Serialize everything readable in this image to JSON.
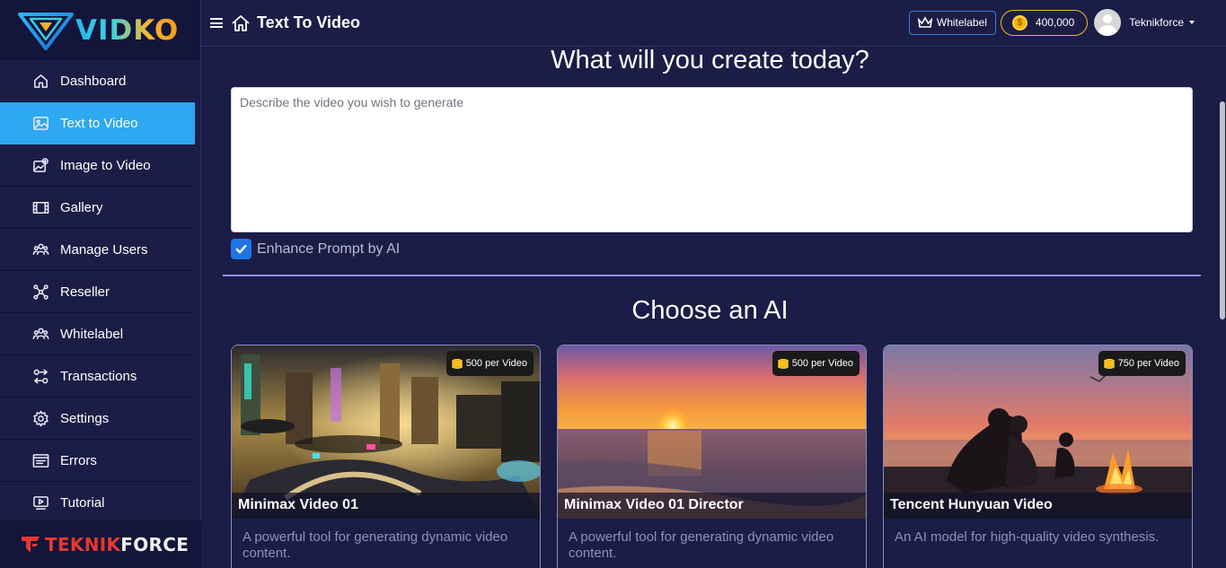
{
  "brand": {
    "logo_text": "VIDKO",
    "footer_red": "TEKNIK",
    "footer_white": "FORCE"
  },
  "sidebar": {
    "items": [
      {
        "label": "Dashboard",
        "icon": "home-icon",
        "active": false
      },
      {
        "label": "Text to Video",
        "icon": "image-icon",
        "active": true
      },
      {
        "label": "Image to Video",
        "icon": "image-edit-icon",
        "active": false
      },
      {
        "label": "Gallery",
        "icon": "film-icon",
        "active": false
      },
      {
        "label": "Manage Users",
        "icon": "users-icon",
        "active": false
      },
      {
        "label": "Reseller",
        "icon": "network-icon",
        "active": false
      },
      {
        "label": "Whitelabel",
        "icon": "users-icon",
        "active": false
      },
      {
        "label": "Transactions",
        "icon": "transactions-icon",
        "active": false
      },
      {
        "label": "Settings",
        "icon": "gear-icon",
        "active": false
      },
      {
        "label": "Errors",
        "icon": "errors-icon",
        "active": false
      },
      {
        "label": "Tutorial",
        "icon": "tutorial-icon",
        "active": false
      }
    ]
  },
  "header": {
    "title": "Text To Video",
    "whitelabel_label": "Whitelabel",
    "credits": "400,000",
    "user_name": "Teknikforce"
  },
  "main": {
    "heading": "What will you create today?",
    "prompt_placeholder": "Describe the video you wish to generate",
    "prompt_value": "",
    "enhance_label": "Enhance Prompt by AI",
    "enhance_checked": true,
    "choose_heading": "Choose an AI",
    "models": [
      {
        "title": "Minimax Video 01",
        "price": "500 per Video",
        "description": "A powerful tool for generating dynamic video content."
      },
      {
        "title": "Minimax Video 01 Director",
        "price": "500 per Video",
        "description": "A powerful tool for generating dynamic video content."
      },
      {
        "title": "Tencent Hunyuan Video",
        "price": "750 per Video",
        "description": "An AI model for high-quality video synthesis."
      }
    ]
  },
  "colors": {
    "background": "#1b1d46",
    "active": "#2ea8f0",
    "accent_gold": "#f1b62a",
    "divider": "#8e93ea"
  }
}
